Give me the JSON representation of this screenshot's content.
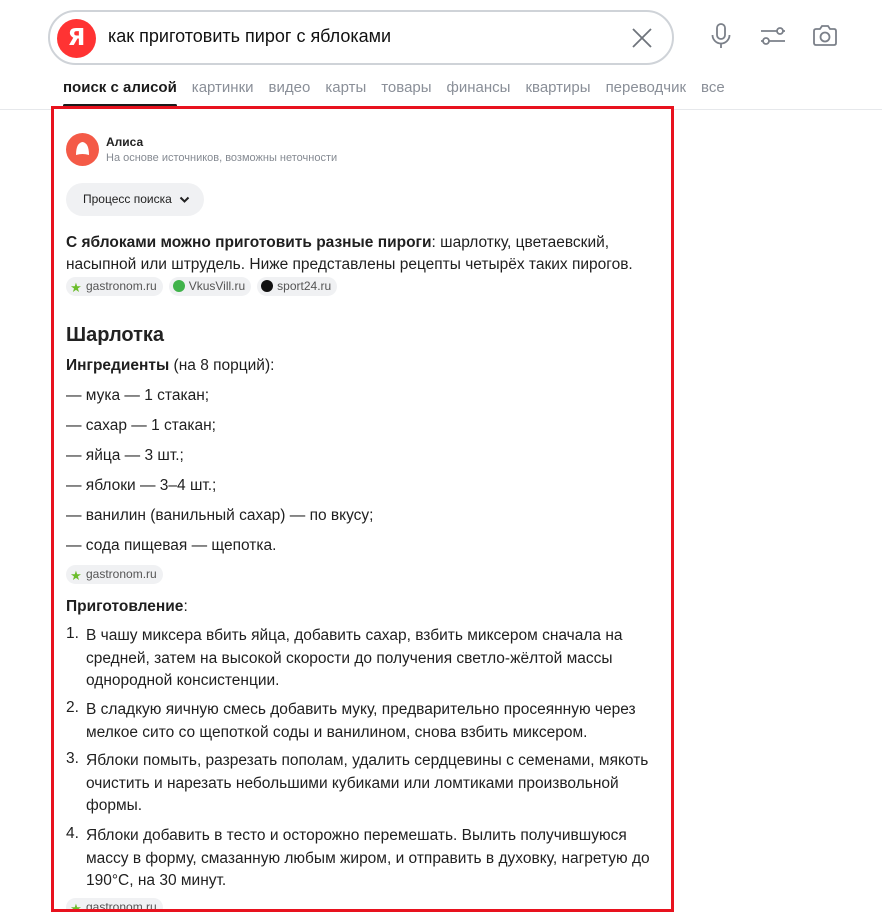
{
  "search": {
    "logo": "Я",
    "query": "как приготовить пирог с яблоками"
  },
  "tabs": [
    {
      "label": "поиск с алисой",
      "active": true
    },
    {
      "label": "картинки"
    },
    {
      "label": "видео"
    },
    {
      "label": "карты"
    },
    {
      "label": "товары"
    },
    {
      "label": "финансы"
    },
    {
      "label": "квартиры"
    },
    {
      "label": "переводчик"
    },
    {
      "label": "все"
    }
  ],
  "alice": {
    "name": "Алиса",
    "subtitle": "На основе источников, возможны неточности",
    "process_label": "Процесс поиска"
  },
  "intro": {
    "bold": "С яблоками можно приготовить разные пироги",
    "rest": ": шарлотку, цветаевский, насыпной или штрудель. Ниже представлены рецепты четырёх таких пирогов."
  },
  "sources": {
    "gastronom": "gastronom.ru",
    "vkusvill": "VkusVill.ru",
    "sport24": "sport24.ru"
  },
  "recipe": {
    "title": "Шарлотка",
    "ingredients_bold": "Ингредиенты",
    "ingredients_rest": " (на 8 порций):",
    "ingredients": [
      "— мука — 1 стакан;",
      "— сахар — 1 стакан;",
      "— яйца — 3 шт.;",
      "— яблоки — 3–4 шт.;",
      "— ванилин (ванильный сахар) — по вкусу;",
      "— сода пищевая — щепотка."
    ],
    "prep_bold": "Приготовление",
    "prep_rest": ":",
    "steps": [
      {
        "num": "1.",
        "text": "В чашу миксера вбить яйца, добавить сахар, взбить миксером сначала на средней, затем на высокой скорости до получения светло-жёлтой массы однородной консистенции."
      },
      {
        "num": "2.",
        "text": "В сладкую яичную смесь добавить муку, предварительно просеянную через мелкое сито со щепоткой соды и ванилином, снова взбить миксером."
      },
      {
        "num": "3.",
        "text": "Яблоки помыть, разрезать пополам, удалить сердцевины с семенами, мякоть очистить и нарезать небольшими кубиками или ломтиками произвольной формы."
      },
      {
        "num": "4.",
        "text": "Яблоки добавить в тесто и осторожно перемешать. Вылить получившуюся массу в форму, смазанную любым жиром, и отправить в духовку, нагретую до 190°C, на 30 минут."
      }
    ]
  },
  "colors": {
    "brand": "#ff3333",
    "alice": "#f45a47",
    "highlight_border": "#e8121e"
  }
}
